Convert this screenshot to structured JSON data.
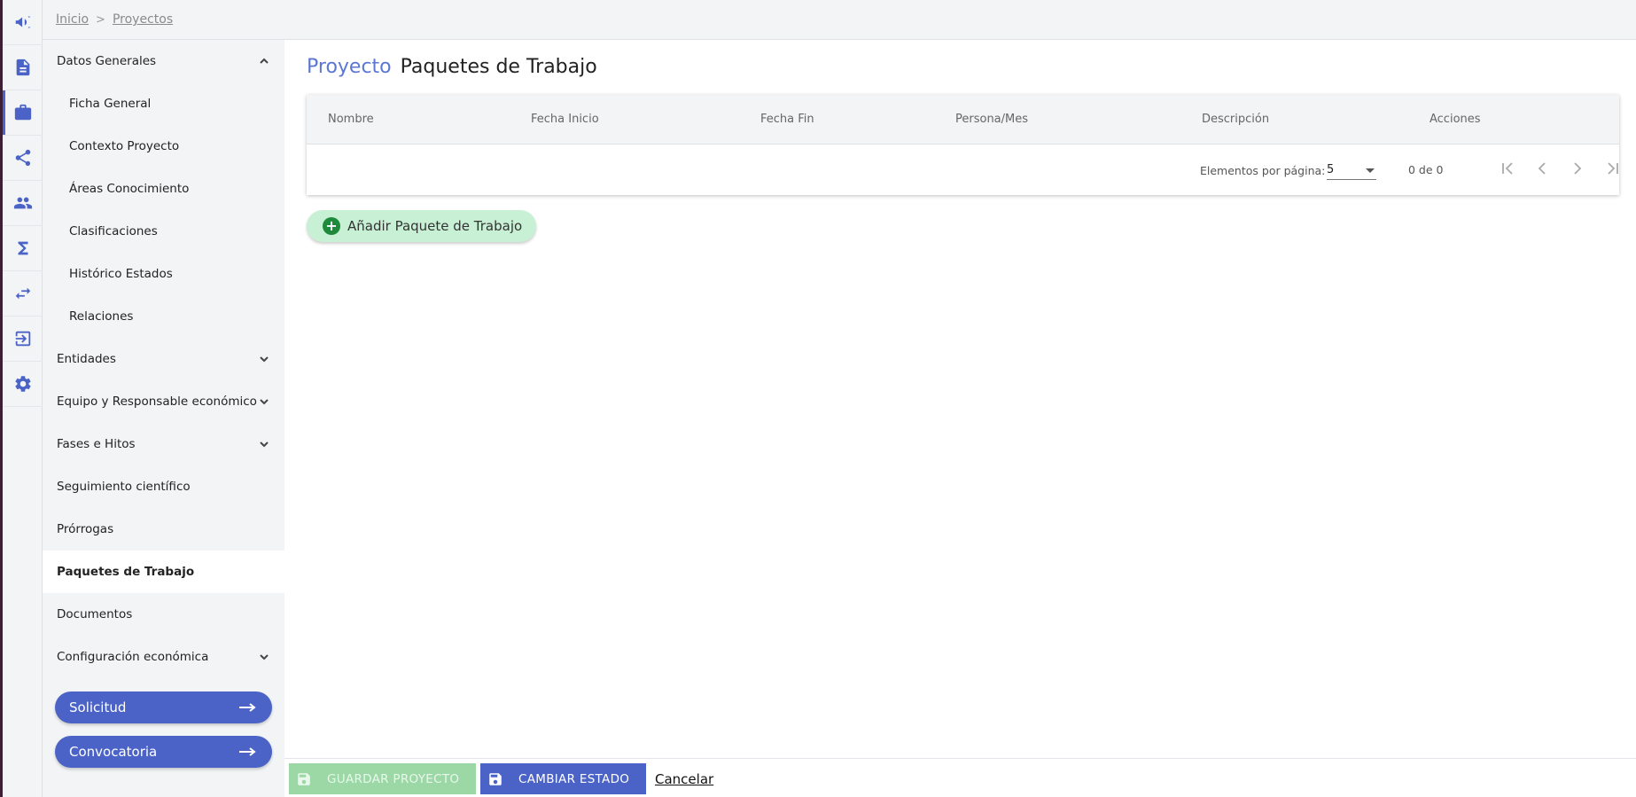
{
  "rail": {
    "icons": [
      "megaphone-icon",
      "document-icon",
      "briefcase-icon",
      "share-icon",
      "people-icon",
      "sigma-icon",
      "transfer-icon",
      "logout-icon",
      "gear-icon"
    ]
  },
  "breadcrumb": {
    "home": "Inicio",
    "current": "Proyectos"
  },
  "sidebar": {
    "sections": [
      {
        "label": "Datos Generales"
      },
      {
        "label": "Ficha General"
      },
      {
        "label": "Contexto Proyecto"
      },
      {
        "label": "Áreas Conocimiento"
      },
      {
        "label": "Clasificaciones"
      },
      {
        "label": "Histórico Estados"
      },
      {
        "label": "Relaciones"
      },
      {
        "label": "Entidades"
      },
      {
        "label": "Equipo y Responsable económico"
      },
      {
        "label": "Fases e Hitos"
      },
      {
        "label": "Seguimiento científico"
      },
      {
        "label": "Prórrogas"
      },
      {
        "label": "Paquetes de Trabajo"
      },
      {
        "label": "Documentos"
      },
      {
        "label": "Configuración económica"
      }
    ],
    "solicitud_label": "Solicitud",
    "convocatoria_label": "Convocatoria"
  },
  "main": {
    "crumb": "Proyecto",
    "title": "Paquetes de Trabajo",
    "table": {
      "columns": [
        "Nombre",
        "Fecha Inicio",
        "Fecha Fin",
        "Persona/Mes",
        "Descripción",
        "Acciones"
      ],
      "rows": []
    },
    "paginator": {
      "items_per_page_label": "Elementos por página:",
      "page_size": "5",
      "range": "0 de 0"
    },
    "add_button_label": "Añadir Paquete de Trabajo"
  },
  "footer": {
    "save_label": "GUARDAR PROYECTO",
    "change_state_label": "CAMBIAR ESTADO",
    "cancel_label": "Cancelar"
  },
  "colors": {
    "accent": "#4b63c7",
    "add_button_bg": "#c7f0d5",
    "save_disabled_bg": "#9bd8a6",
    "sidebar_bg": "#f2f4f6"
  }
}
